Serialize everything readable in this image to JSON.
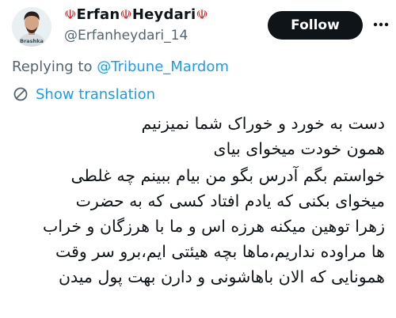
{
  "author": {
    "display_name_prefix": "☫",
    "display_name_first": "Erfan",
    "display_name_separator": "☫",
    "display_name_last": "Heydari",
    "display_name_suffix": "☫",
    "handle": "@Erfanheydari_14",
    "avatar_text": "Brashka",
    "brand_color": "#c62828"
  },
  "actions": {
    "follow_label": "Follow",
    "more_icon": "more-horizontal-icon"
  },
  "reply": {
    "prefix": "Replying to",
    "mention": "@Tribune_Mardom"
  },
  "translation": {
    "label": "Show translation",
    "icon": "translate-icon"
  },
  "tweet": {
    "lines": [
      "دست به خورد و خوراک شما نمیزنیم",
      "همون خودت میخوای بیای",
      "خواستم بگم آدرس بگو من بیام ببینم چه غلطی",
      "میخوای بکنی که یادم افتاد کسی که به حضرت",
      "زهرا توهین میکنه هرزه اس و ما با هرزگان و خراب",
      "ها مراوده نداریم،ماها بچه هیئتی ایم،برو سر وقت",
      "همونایی که الان باهاشونی و دارن بهت پول میدن"
    ]
  },
  "colors": {
    "text_primary": "#0f1419",
    "text_secondary": "#536471",
    "link": "#1d9bf0",
    "button_bg": "#0f1419"
  }
}
